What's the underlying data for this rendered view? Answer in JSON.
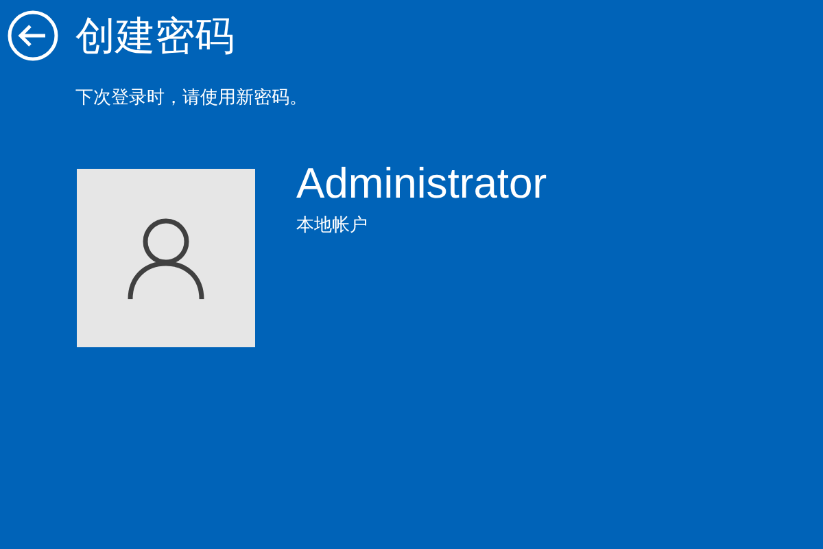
{
  "header": {
    "title": "创建密码",
    "subtitle": "下次登录时，请使用新密码。"
  },
  "account": {
    "name": "Administrator",
    "type": "本地帐户"
  }
}
